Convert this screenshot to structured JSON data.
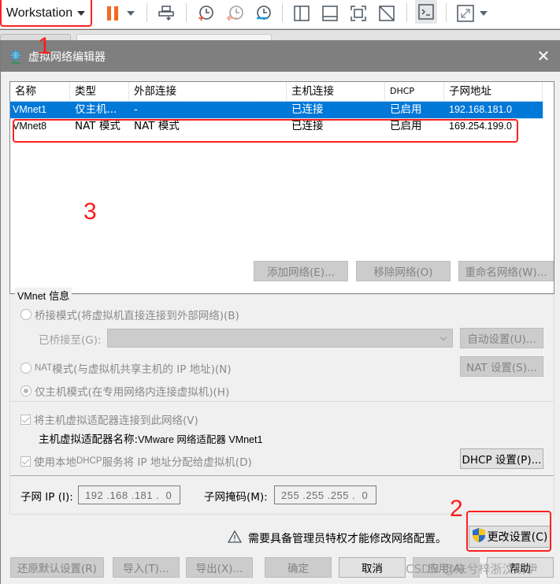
{
  "toolbar": {
    "product_label": "Workstation",
    "icons": [
      "pause-icon",
      "send-ctrl-alt-del-icon",
      "snapshot-take-icon",
      "snapshot-revert-icon",
      "snapshot-manager-icon",
      "view-sidebar-icon",
      "view-bottom-panel-icon",
      "fullscreen-icon",
      "unity-disabled-icon",
      "console-view-icon",
      "stretch-view-icon"
    ]
  },
  "dialog": {
    "title": "虚拟网络编辑器",
    "close_glyph": "✕",
    "table": {
      "columns": [
        "名称",
        "类型",
        "外部连接",
        "主机连接",
        "DHCP",
        "子网地址"
      ],
      "rows": [
        {
          "name": "VMnet1",
          "type": "仅主机...",
          "external": "-",
          "host": "已连接",
          "dhcp": "已启用",
          "subnet": "192.168.181.0",
          "selected": true
        },
        {
          "name": "VMnet8",
          "type": "NAT 模式",
          "external": "NAT 模式",
          "host": "已连接",
          "dhcp": "已启用",
          "subnet": "169.254.199.0",
          "selected": false
        }
      ]
    },
    "list_buttons": {
      "add": "添加网络(E)...",
      "remove": "移除网络(O)",
      "rename": "重命名网络(W)..."
    },
    "vmnet_info": {
      "group_label_en": "VMnet",
      "group_label_cn": " 信息",
      "bridged_label": "桥接模式(将虚拟机直接连接到外部网络)(B)",
      "bridged_to_label": "已桥接至(G):",
      "bridged_to_value": "",
      "auto_settings": "自动设置(U)...",
      "nat_label_prefix": "NAT",
      "nat_label": " 模式(与虚拟机共享主机的 IP 地址)(N)",
      "nat_settings": "NAT 设置(S)...",
      "hostonly_label": "仅主机模式(在专用网络内连接虚拟机)(H)",
      "selected_mode": "host-only",
      "connect_adapter_label": "将主机虚拟适配器连接到此网络(V)",
      "connect_adapter_checked": true,
      "adapter_name_label": "主机虚拟适配器名称: ",
      "adapter_name_value": "VMware 网络适配器 VMnet1",
      "dhcp_label_a": "使用本地 ",
      "dhcp_label_b": "DHCP",
      "dhcp_label_c": " 服务将 IP 地址分配给虚拟机(D)",
      "dhcp_checked": true,
      "dhcp_settings": "DHCP 设置(P)...",
      "subnet_ip_label": "子网 IP (I):",
      "subnet_ip_value": "192 .168 .181 .  0",
      "subnet_mask_label": "子网掩码(M):",
      "subnet_mask_value": "255 .255 .255 .  0"
    },
    "admin_notice": "需要具备管理员特权才能修改网络配置。",
    "change_settings": "更改设置(C)",
    "bottom_buttons": {
      "restore": "还原默认设置(R)",
      "import": "导入(T)...",
      "export": "导出(X)...",
      "ok": "确定",
      "cancel": "取消",
      "apply": "应用(A)",
      "help": "帮助"
    }
  },
  "annotations": {
    "one": "1",
    "two": "2",
    "three": "3",
    "color": "#ff2020"
  },
  "watermark": "CSDN @朱兮梓浙汶斯伊"
}
